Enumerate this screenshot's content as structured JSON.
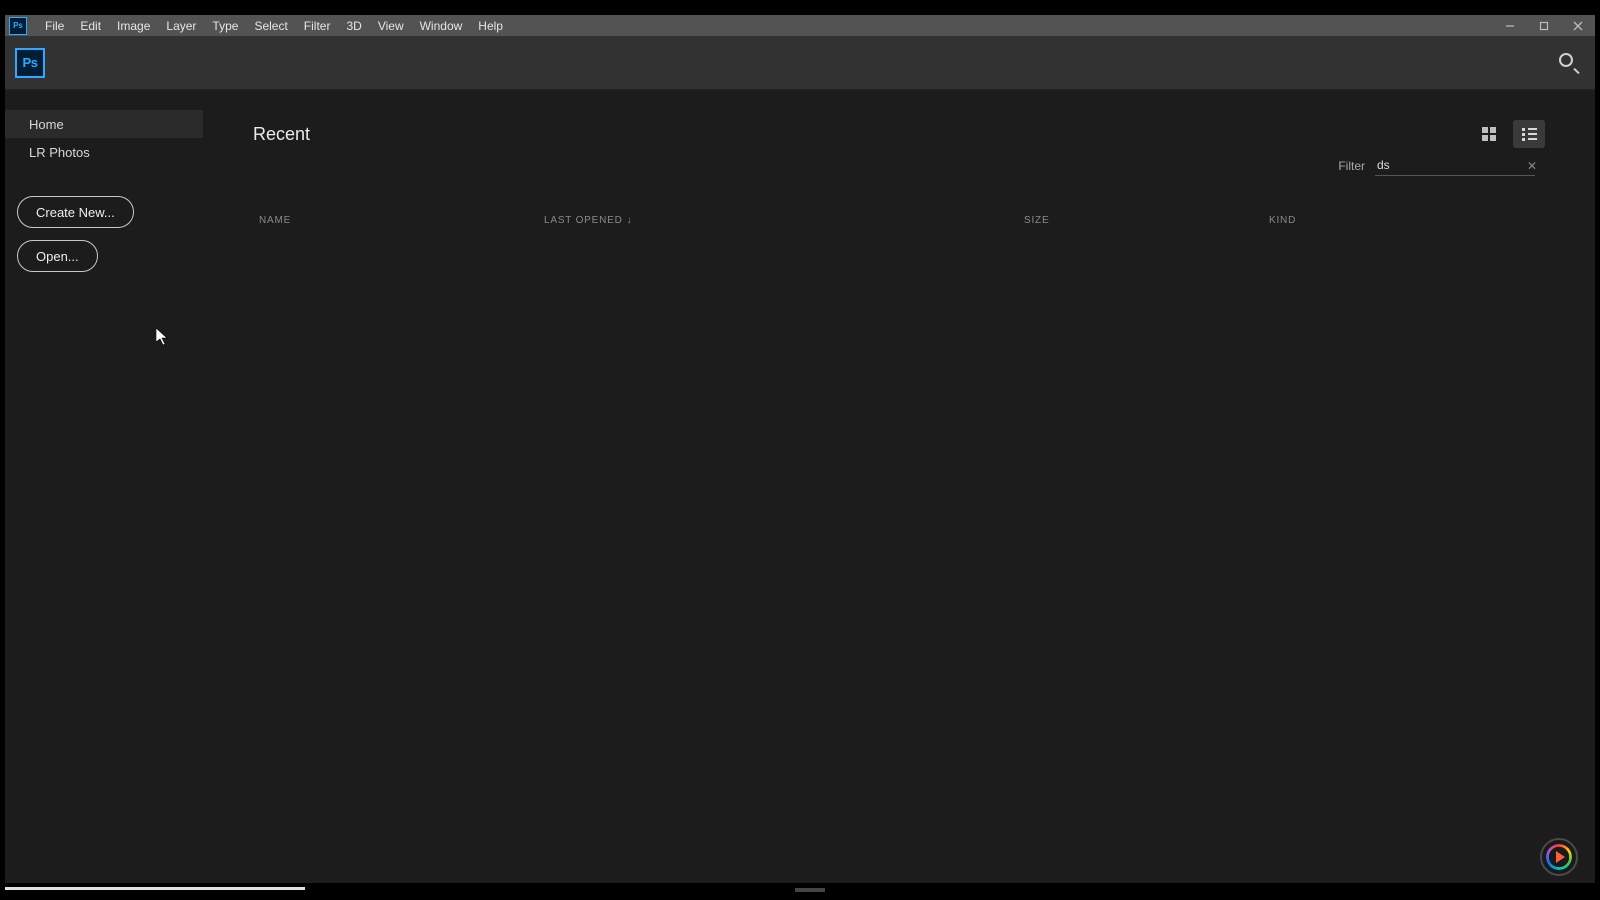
{
  "menubar": {
    "items": [
      "File",
      "Edit",
      "Image",
      "Layer",
      "Type",
      "Select",
      "Filter",
      "3D",
      "View",
      "Window",
      "Help"
    ]
  },
  "app": {
    "logo_text": "Ps"
  },
  "sidebar": {
    "nav": [
      {
        "label": "Home",
        "active": true
      },
      {
        "label": "LR Photos",
        "active": false
      }
    ],
    "create_label": "Create New...",
    "open_label": "Open..."
  },
  "main": {
    "heading": "Recent",
    "filter_label": "Filter",
    "filter_value": "ds",
    "columns": {
      "name": "NAME",
      "last_opened": "LAST OPENED",
      "size": "SIZE",
      "kind": "KIND"
    }
  }
}
